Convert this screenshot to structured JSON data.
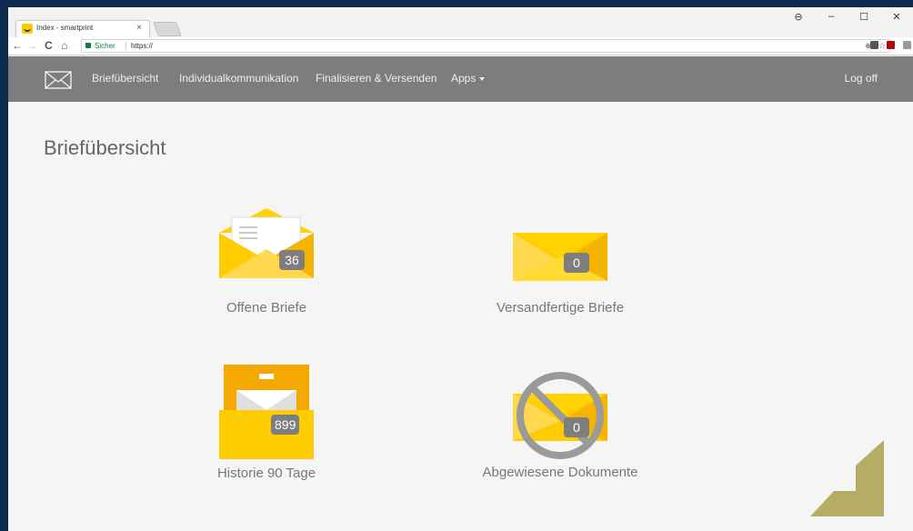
{
  "browser": {
    "tab_title": "Index - smartprint",
    "tab_close": "×",
    "secure_label": "Sicher",
    "url": "https://",
    "window_controls": {
      "profile": "⊖",
      "minimize": "–",
      "maximize": "☐",
      "close": "✕"
    },
    "nav": {
      "back": "←",
      "forward": "→",
      "reload": "C",
      "home": "⌂"
    }
  },
  "navbar": {
    "items": [
      {
        "label": "Briefübersicht"
      },
      {
        "label": "Individualkommunikation"
      },
      {
        "label": "Finalisieren & Versenden"
      },
      {
        "label": "Apps"
      }
    ],
    "logoff": "Log off"
  },
  "page": {
    "title": "Briefübersicht"
  },
  "tiles": [
    {
      "label": "Offene Briefe",
      "count": "36",
      "icon": "open-envelope-icon"
    },
    {
      "label": "Versandfertige Briefe",
      "count": "0",
      "icon": "closed-envelope-icon"
    },
    {
      "label": "Historie 90 Tage",
      "count": "899",
      "icon": "archive-box-icon"
    },
    {
      "label": "Abgewiesene Dokumente",
      "count": "0",
      "icon": "rejected-envelope-icon"
    }
  ],
  "colors": {
    "accent_yellow": "#ffcc00",
    "dark_yellow": "#f5b400",
    "navbar": "#7d7d7d",
    "badge": "#7e7e7e",
    "deco_olive": "#b5ad63"
  }
}
